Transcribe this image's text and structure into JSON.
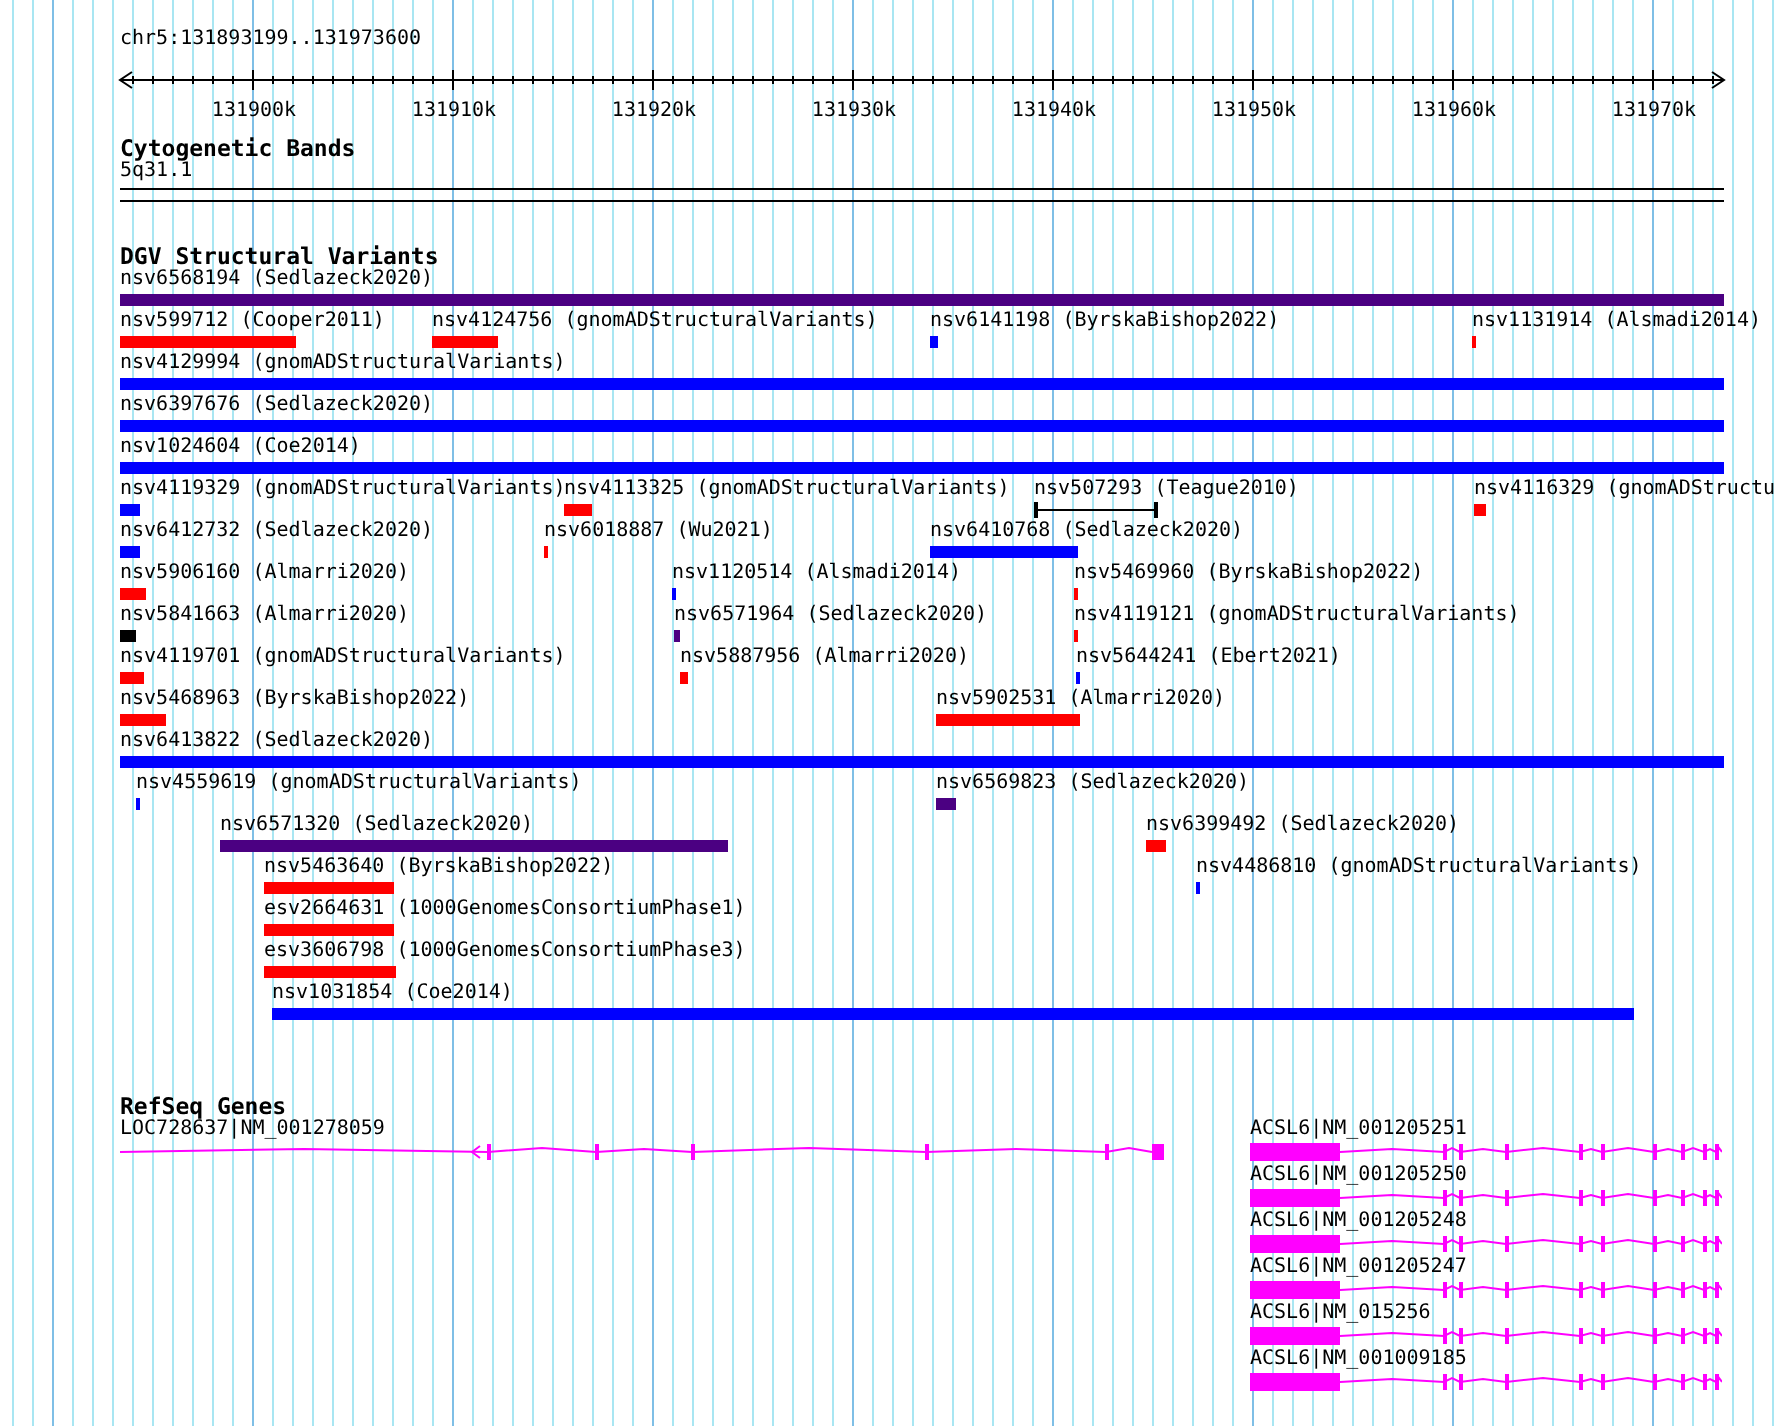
{
  "ruler": {
    "location": "chr5:131893199..131973600",
    "ticks": [
      "131900k",
      "131910k",
      "131920k",
      "131930k",
      "131940k",
      "131950k",
      "131960k",
      "131970k"
    ]
  },
  "cytogenetic_bands": {
    "title": "Cytogenetic Bands",
    "band": "5q31.1"
  },
  "dgv": {
    "title": "DGV Structural Variants",
    "rows": [
      {
        "features": [
          {
            "label": "nsv6568194 (Sedlazeck2020)",
            "kind": "bar",
            "color": "#4b0082"
          }
        ]
      },
      {
        "features": [
          {
            "label": "nsv599712 (Cooper2011)",
            "kind": "bar",
            "color": "#ff0000"
          },
          {
            "label": "nsv4124756 (gnomADStructuralVariants)",
            "kind": "bar",
            "color": "#ff0000"
          },
          {
            "label": "nsv6141198 (ByrskaBishop2022)",
            "kind": "bar",
            "color": "#0000ff"
          },
          {
            "label": "nsv1131914 (Alsmadi2014)",
            "kind": "bar",
            "color": "#ff0000"
          }
        ]
      },
      {
        "features": [
          {
            "label": "nsv4129994 (gnomADStructuralVariants)",
            "kind": "bar",
            "color": "#0000ff"
          }
        ]
      },
      {
        "features": [
          {
            "label": "nsv6397676 (Sedlazeck2020)",
            "kind": "bar",
            "color": "#0000ff"
          }
        ]
      },
      {
        "features": [
          {
            "label": "nsv1024604 (Coe2014)",
            "kind": "bar",
            "color": "#0000ff"
          }
        ]
      },
      {
        "features": [
          {
            "label": "nsv4119329 (gnomADStructuralVariants)",
            "kind": "bar",
            "color": "#0000ff"
          },
          {
            "label": "nsv4113325 (gnomADStructuralVariants)",
            "kind": "bar",
            "color": "#ff0000"
          },
          {
            "label": "nsv507293 (Teague2010)",
            "kind": "range",
            "color": "#000000"
          },
          {
            "label": "nsv4116329 (gnomADStructu",
            "kind": "bar",
            "color": "#ff0000"
          }
        ]
      },
      {
        "features": [
          {
            "label": "nsv6412732 (Sedlazeck2020)",
            "kind": "bar",
            "color": "#0000ff"
          },
          {
            "label": "nsv6018887 (Wu2021)",
            "kind": "bar",
            "color": "#ff0000"
          },
          {
            "label": "nsv6410768 (Sedlazeck2020)",
            "kind": "bar",
            "color": "#0000ff"
          }
        ]
      },
      {
        "features": [
          {
            "label": "nsv5906160 (Almarri2020)",
            "kind": "bar",
            "color": "#ff0000"
          },
          {
            "label": "nsv1120514 (Alsmadi2014)",
            "kind": "bar",
            "color": "#0000ff"
          },
          {
            "label": "nsv5469960 (ByrskaBishop2022)",
            "kind": "bar",
            "color": "#ff0000"
          }
        ]
      },
      {
        "features": [
          {
            "label": "nsv5841663 (Almarri2020)",
            "kind": "bar",
            "color": "#000000"
          },
          {
            "label": "nsv6571964 (Sedlazeck2020)",
            "kind": "bar",
            "color": "#4b0082"
          },
          {
            "label": "nsv4119121 (gnomADStructuralVariants)",
            "kind": "bar",
            "color": "#ff0000"
          }
        ]
      },
      {
        "features": [
          {
            "label": "nsv4119701 (gnomADStructuralVariants)",
            "kind": "bar",
            "color": "#ff0000"
          },
          {
            "label": "nsv5887956 (Almarri2020)",
            "kind": "bar",
            "color": "#ff0000"
          },
          {
            "label": "nsv5644241 (Ebert2021)",
            "kind": "bar",
            "color": "#0000ff"
          }
        ]
      },
      {
        "features": [
          {
            "label": "nsv5468963 (ByrskaBishop2022)",
            "kind": "bar",
            "color": "#ff0000"
          },
          {
            "label": "nsv5902531 (Almarri2020)",
            "kind": "bar",
            "color": "#ff0000"
          }
        ]
      },
      {
        "features": [
          {
            "label": "nsv6413822 (Sedlazeck2020)",
            "kind": "bar",
            "color": "#0000ff"
          }
        ]
      },
      {
        "features": [
          {
            "label": "nsv4559619 (gnomADStructuralVariants)",
            "kind": "bar",
            "color": "#0000ff"
          },
          {
            "label": "nsv6569823 (Sedlazeck2020)",
            "kind": "bar",
            "color": "#4b0082"
          }
        ]
      },
      {
        "features": [
          {
            "label": "nsv6571320 (Sedlazeck2020)",
            "kind": "bar",
            "color": "#4b0082"
          },
          {
            "label": "nsv6399492 (Sedlazeck2020)",
            "kind": "bar",
            "color": "#ff0000"
          }
        ]
      },
      {
        "features": [
          {
            "label": "nsv5463640 (ByrskaBishop2022)",
            "kind": "bar",
            "color": "#ff0000"
          },
          {
            "label": "nsv4486810 (gnomADStructuralVariants)",
            "kind": "bar",
            "color": "#0000ff"
          }
        ]
      },
      {
        "features": [
          {
            "label": "esv2664631 (1000GenomesConsortiumPhase1)",
            "kind": "bar",
            "color": "#ff0000"
          }
        ]
      },
      {
        "features": [
          {
            "label": "esv3606798 (1000GenomesConsortiumPhase3)",
            "kind": "bar",
            "color": "#ff0000"
          }
        ]
      },
      {
        "features": [
          {
            "label": "nsv1031854 (Coe2014)",
            "kind": "bar",
            "color": "#0000ff"
          }
        ]
      }
    ]
  },
  "refseq": {
    "title": "RefSeq Genes",
    "genes": [
      {
        "label": "LOC728637|NM_001278059"
      },
      {
        "label": "ACSL6|NM_001205251"
      },
      {
        "label": "ACSL6|NM_001205250"
      },
      {
        "label": "ACSL6|NM_001205248"
      },
      {
        "label": "ACSL6|NM_001205247"
      },
      {
        "label": "ACSL6|NM_015256"
      },
      {
        "label": "ACSL6|NM_001009185"
      }
    ]
  }
}
